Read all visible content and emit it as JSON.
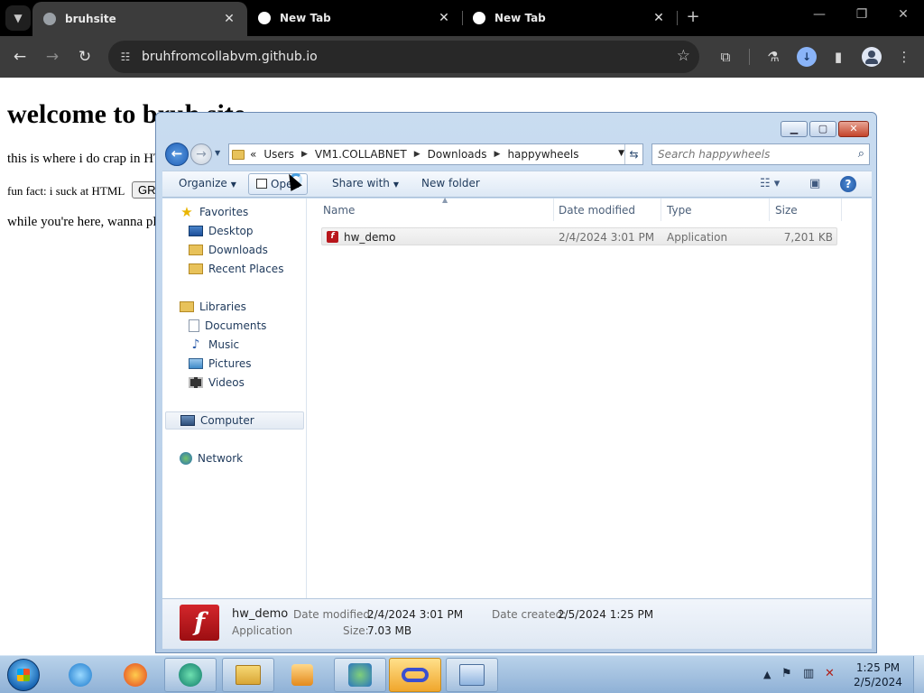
{
  "browser": {
    "tabs": [
      {
        "title": "bruhsite",
        "active": true
      },
      {
        "title": "New Tab",
        "active": false
      },
      {
        "title": "New Tab",
        "active": false
      }
    ],
    "close_glyph": "✕",
    "new_tab_glyph": "+",
    "url": "bruhfromcollabvm.github.io"
  },
  "webpage": {
    "heading": "welcome to bruh site",
    "line1": "this is where i do crap in HTML",
    "line2": "fun fact: i suck at HTML",
    "line2_button": "GRRR",
    "line3": "while you're here, wanna play something?"
  },
  "explorer": {
    "breadcrumb": [
      "«",
      "Users",
      "VM1.COLLABNET",
      "Downloads",
      "happywheels"
    ],
    "search_placeholder": "Search happywheels",
    "commands": {
      "organize": "Organize",
      "open": "Open",
      "share_with": "Share with",
      "new_folder": "New folder"
    },
    "nav": {
      "favorites": "Favorites",
      "desktop": "Desktop",
      "downloads": "Downloads",
      "recent_places": "Recent Places",
      "libraries": "Libraries",
      "documents": "Documents",
      "music": "Music",
      "pictures": "Pictures",
      "videos": "Videos",
      "computer": "Computer",
      "network": "Network"
    },
    "columns": {
      "name": "Name",
      "date_modified": "Date modified",
      "type": "Type",
      "size": "Size"
    },
    "files": [
      {
        "name": "hw_demo",
        "date_modified": "2/4/2024 3:01 PM",
        "type": "Application",
        "size": "7,201 KB"
      }
    ],
    "details": {
      "name": "hw_demo",
      "kind": "Application",
      "date_modified_label": "Date modified:",
      "date_modified": "2/4/2024 3:01 PM",
      "date_created_label": "Date created:",
      "date_created": "2/5/2024 1:25 PM",
      "size_label": "Size:",
      "size": "7.03 MB"
    }
  },
  "taskbar": {
    "time": "1:25 PM",
    "date": "2/5/2024"
  },
  "colors": {
    "chrome_bg": "#000000",
    "chrome_toolbar": "#3c3c3c",
    "aero_frame": "#c9dcf0",
    "flash_red": "#b8161b",
    "taskbar": "#9fbfe0"
  }
}
